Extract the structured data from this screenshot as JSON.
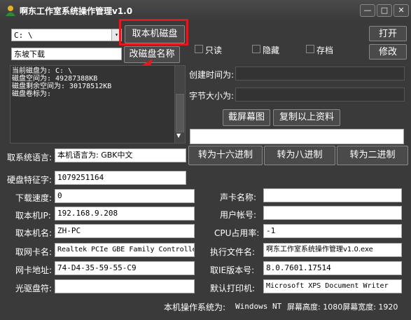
{
  "window": {
    "title": "啊东工作室系统操作管理v1.0",
    "minimize": "—",
    "maximize": "□",
    "close": "✕"
  },
  "drive": {
    "selected": "C: \\",
    "dropdown_arrow": "▾",
    "get_disk_button": "取本机磁盘",
    "label_input": "东坡下载",
    "rename_button": "改磁盘名称"
  },
  "checkboxes": {
    "readonly": "只读",
    "hidden": "隐藏",
    "archive": "存档"
  },
  "right_buttons": {
    "open": "打开",
    "modify": "修改"
  },
  "disk_info": {
    "line1": "当前磁盘为: C: \\",
    "line2": "磁盘空间为: 49287388KB",
    "line3": "磁盘剩余空间为: 30178512KB",
    "line4": "磁盘卷标为:"
  },
  "file_info": {
    "created_label": "创建时间为:",
    "size_label": "字节大小为:",
    "screenshot_button": "截屏幕图",
    "copy_button": "复制以上资料"
  },
  "scroll": {
    "up": "▲",
    "down": "▼"
  },
  "language": {
    "label": "取系统语言:",
    "value": "本机语言为: GBK中文"
  },
  "convert": {
    "hex": "转为十六进制",
    "octal": "转为八进制",
    "binary": "转为二进制"
  },
  "disk_serial": {
    "label": "硬盘特征字:",
    "value": "1079251164"
  },
  "left_fields": [
    {
      "label": "下载速度:",
      "value": "0"
    },
    {
      "label": "取本机IP:",
      "value": "192.168.9.208"
    },
    {
      "label": "取本机名:",
      "value": "ZH-PC"
    },
    {
      "label": "取网卡名:",
      "value": "Realtek PCIe GBE Family Controller"
    },
    {
      "label": "网卡地址:",
      "value": "74-D4-35-59-55-C9"
    },
    {
      "label": "光驱盘符:",
      "value": ""
    }
  ],
  "right_fields": [
    {
      "label": "声卡名称:",
      "value": ""
    },
    {
      "label": "用户帐号:",
      "value": ""
    },
    {
      "label": "CPU占用率:",
      "value": "-1"
    },
    {
      "label": "执行文件名:",
      "value": "啊东工作室系统操作管理v1.0.exe"
    },
    {
      "label": "取IE版本号:",
      "value": "8.0.7601.17514"
    },
    {
      "label": "默认打印机:",
      "value": "Microsoft XPS Document Writer"
    }
  ],
  "status": {
    "os_label": "本机操作系统为:",
    "os_value": "Windows NT",
    "resolution": "屏幕高度: 1080屏幕宽度: 1920"
  },
  "annotation": {
    "color": "#e0191e"
  }
}
